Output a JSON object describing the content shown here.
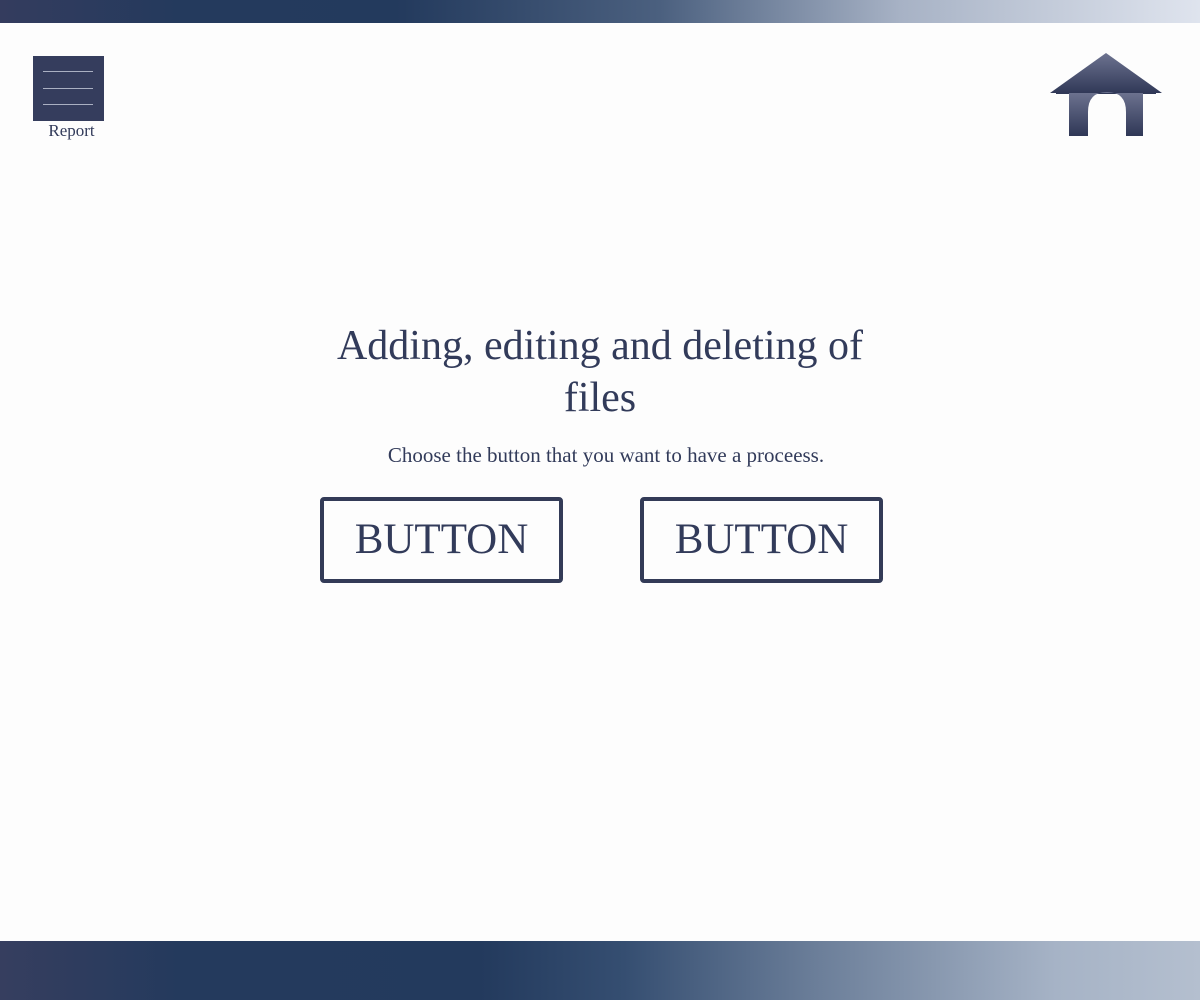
{
  "menu": {
    "label": "Report",
    "icon": "hamburger-menu-icon"
  },
  "home": {
    "icon": "home-icon"
  },
  "main": {
    "title": "Adding, editing and deleting of files",
    "subtitle": "Choose the button that you want to have a proceess.",
    "buttons": [
      {
        "label": "BUTTON"
      },
      {
        "label": "BUTTON"
      }
    ]
  },
  "colors": {
    "primary": "#323b5a",
    "background": "#fdfdfd",
    "bar_dark": "#233a5d",
    "bar_light": "#dfe4ee"
  }
}
